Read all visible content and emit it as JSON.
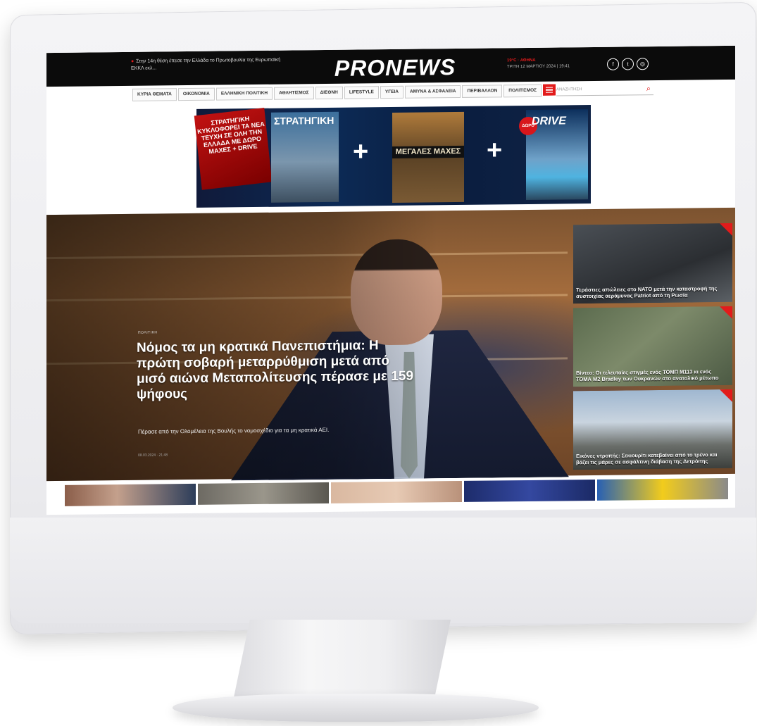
{
  "site": {
    "logo": "PRONEWS",
    "breaking": "Στην 14η θέση έπεσε την Ελλάδα το Πρωτοβουλία της Ευρωπαϊκή ΕΚΚΛ εκλ..."
  },
  "weather": {
    "temp": "19°C · ΑΘΗΝΑ",
    "date": "ΤΡΙΤΗ 12 ΜΑΡΤΙΟΥ 2024 | 19:41"
  },
  "social": [
    {
      "icon": "facebook-icon",
      "glyph": "f"
    },
    {
      "icon": "twitter-icon",
      "glyph": "t"
    },
    {
      "icon": "instagram-icon",
      "glyph": "◎"
    }
  ],
  "nav": [
    "ΚΥΡΙΑ ΘΕΜΑΤΑ",
    "ΟΙΚΟΝΟΜΙΑ",
    "ΕΛΛΗΝΙΚΗ ΠΟΛΙΤΙΚΗ",
    "ΑΘΛΗΤΙΣΜΟΣ",
    "ΔΙΕΘΝΗ",
    "LIFESTYLE",
    "ΥΓΕΙΑ",
    "ΑΜΥΝΑ & ΑΣΦΑΛΕΙΑ",
    "ΠΕΡΙΒΑΛΛΟΝ",
    "ΠΟΛΙΤΙΣΜΟΣ"
  ],
  "search": {
    "placeholder": "ΑΝΑΖΗΤΗΣΗ"
  },
  "banner": {
    "cover1": "ΣΤΡΑΤΗΓΙΚΗ ΚΥΚΛΟΦΟΡΕΙ ΤΑ ΝΕΑ ΤΕΥΧΗ ΣΕ ΟΛΗ ΤΗΝ ΕΛΛΑΔΑ ΜΕ ΔΩΡΟ ΜΑΧΕΣ + DRIVE",
    "mag1": "ΣΤΡΑΤΗΓΙΚΗ",
    "mag2": "ΜΕΓΑΛΕΣ ΜΑΧΕΣ",
    "gift": "ΔΩΡΟ",
    "drive": "DRIVE",
    "plus": "+"
  },
  "hero": {
    "category": "ΠΟΛΙΤΙΚΗ",
    "title": "Νόμος τα μη κρατικά Πανεπιστήμια: Η πρώτη σοβαρή μεταρρύθμιση μετά από μισό αιώνα Μεταπολίτευσης πέρασε με 159 ψήφους",
    "subtitle": "Πέρασε από την Ολομέλεια της Βουλής το νομοσχέδιο για τα μη κρατικά ΑΕΙ.",
    "date": "08.03.2024 · 21:48"
  },
  "side_stories": [
    {
      "caption": "Τεράστιες απώλειες στο ΝΑΤΟ μετά την καταστροφή της συστοιχίας αεράμυνας Patriot από τη Ρωσία"
    },
    {
      "caption": "Βίντεο: Οι τελευταίες στιγμές ενός ΤΟΜΠ M113 κι ενός ΤΟΜΑ M2 Bradley των Ουκρανών στο ανατολικό μέτωπο"
    },
    {
      "caption": "Εικόνες ντροπής: Σεκιουρίτι κατεβαίνει από το τρένο και βάζει τις μάρες σε ασφάλτινη διάβαση της Δετρόιτης"
    }
  ],
  "colors": {
    "accent": "#e21b1b",
    "topbar": "#0b0b0b"
  }
}
